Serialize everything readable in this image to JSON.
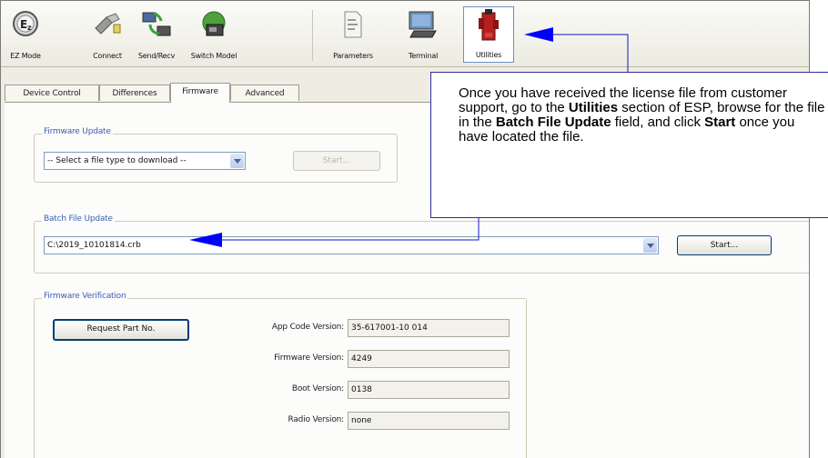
{
  "toolbar": {
    "items": [
      {
        "label": "EZ Mode",
        "icon": "ez-mode-icon"
      },
      {
        "label": "Connect",
        "icon": "connect-icon"
      },
      {
        "label": "Send/Recv",
        "icon": "send-recv-icon"
      },
      {
        "label": "Switch Model",
        "icon": "switch-model-icon"
      },
      {
        "label": "Parameters",
        "icon": "parameters-icon"
      },
      {
        "label": "Terminal",
        "icon": "terminal-icon"
      },
      {
        "label": "Utilities",
        "icon": "utilities-icon"
      }
    ]
  },
  "tabs": [
    "Device Control",
    "Differences",
    "Firmware",
    "Advanced"
  ],
  "firmware_update": {
    "title": "Firmware Update",
    "select_value": "-- Select a file type to download --",
    "start_label": "Start..."
  },
  "batch_file_update": {
    "title": "Batch File Update",
    "path_value": "C:\\2019_10101814.crb",
    "start_label": "Start..."
  },
  "firmware_verification": {
    "title": "Firmware Verification",
    "request_label": "Request Part No.",
    "fields": [
      {
        "label": "App Code Version:",
        "value": "35-617001-10 014"
      },
      {
        "label": "Firmware Version:",
        "value": "4249"
      },
      {
        "label": "Boot Version:",
        "value": "0138"
      },
      {
        "label": "Radio Version:",
        "value": "none"
      }
    ]
  },
  "callout": {
    "t1": "Once you have received the license file from customer support, go to the ",
    "b1": "Utilities",
    "t2": " section of ESP, browse for the file in the ",
    "b2": "Batch File Update",
    "t3": " field, and click ",
    "b3": "Start",
    "t4": " once you have located the file."
  },
  "colors": {
    "callout_border": "#2c2c9e",
    "arrow": "#0000ff",
    "group_title": "#3a5fb3"
  }
}
